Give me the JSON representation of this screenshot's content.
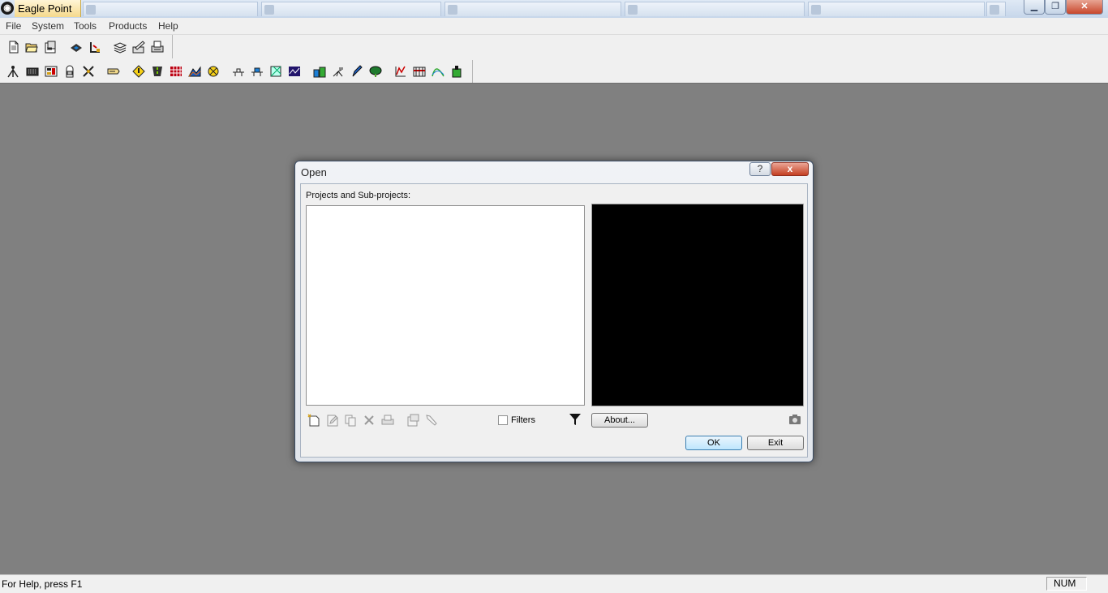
{
  "window": {
    "title": "Eagle Point",
    "app_icon": "eagle-point-logo",
    "background_tabs": [
      "",
      "",
      "",
      "",
      "",
      ""
    ],
    "controls": {
      "minimize": "minimize-icon",
      "restore": "restore-icon",
      "close": "close-icon"
    }
  },
  "menu": {
    "items": [
      "File",
      "System",
      "Tools",
      "Products",
      "Help"
    ]
  },
  "toolbar1": {
    "icons": [
      "new-icon",
      "open-folder-icon",
      "properties-icon",
      "import-icon",
      "export-icon",
      "layers-icon",
      "edit-icon",
      "print-icon"
    ]
  },
  "toolbar2": {
    "icons": [
      "survey-icon",
      "keyboard-icon",
      "calculator-icon",
      "backpack-icon",
      "crossroads-icon",
      "label-icon",
      "diamond-sign-icon",
      "road-icon",
      "grid-icon",
      "terrain-icon",
      "compass-icon",
      "profile-icon",
      "pipe-icon",
      "boundary-icon",
      "graph-icon",
      "building-icon",
      "transit-icon",
      "pen-icon",
      "tree-icon",
      "chart-icon",
      "survey-grid-icon",
      "curve-icon",
      "tower-icon"
    ]
  },
  "dialog": {
    "title": "Open",
    "help_label": "?",
    "close_label": "x",
    "projects_label": "Projects and Sub-projects:",
    "filters_label": "Filters",
    "filters_checked": false,
    "about_label": "About...",
    "ok_label": "OK",
    "exit_label": "Exit",
    "list_icons": [
      "new-project-icon",
      "edit-project-icon",
      "copy-project-icon",
      "delete-project-icon",
      "print-project-icon",
      "project-properties-icon",
      "pick-icon"
    ]
  },
  "status": {
    "help_text": "For Help, press F1",
    "num_indicator": "NUM"
  }
}
